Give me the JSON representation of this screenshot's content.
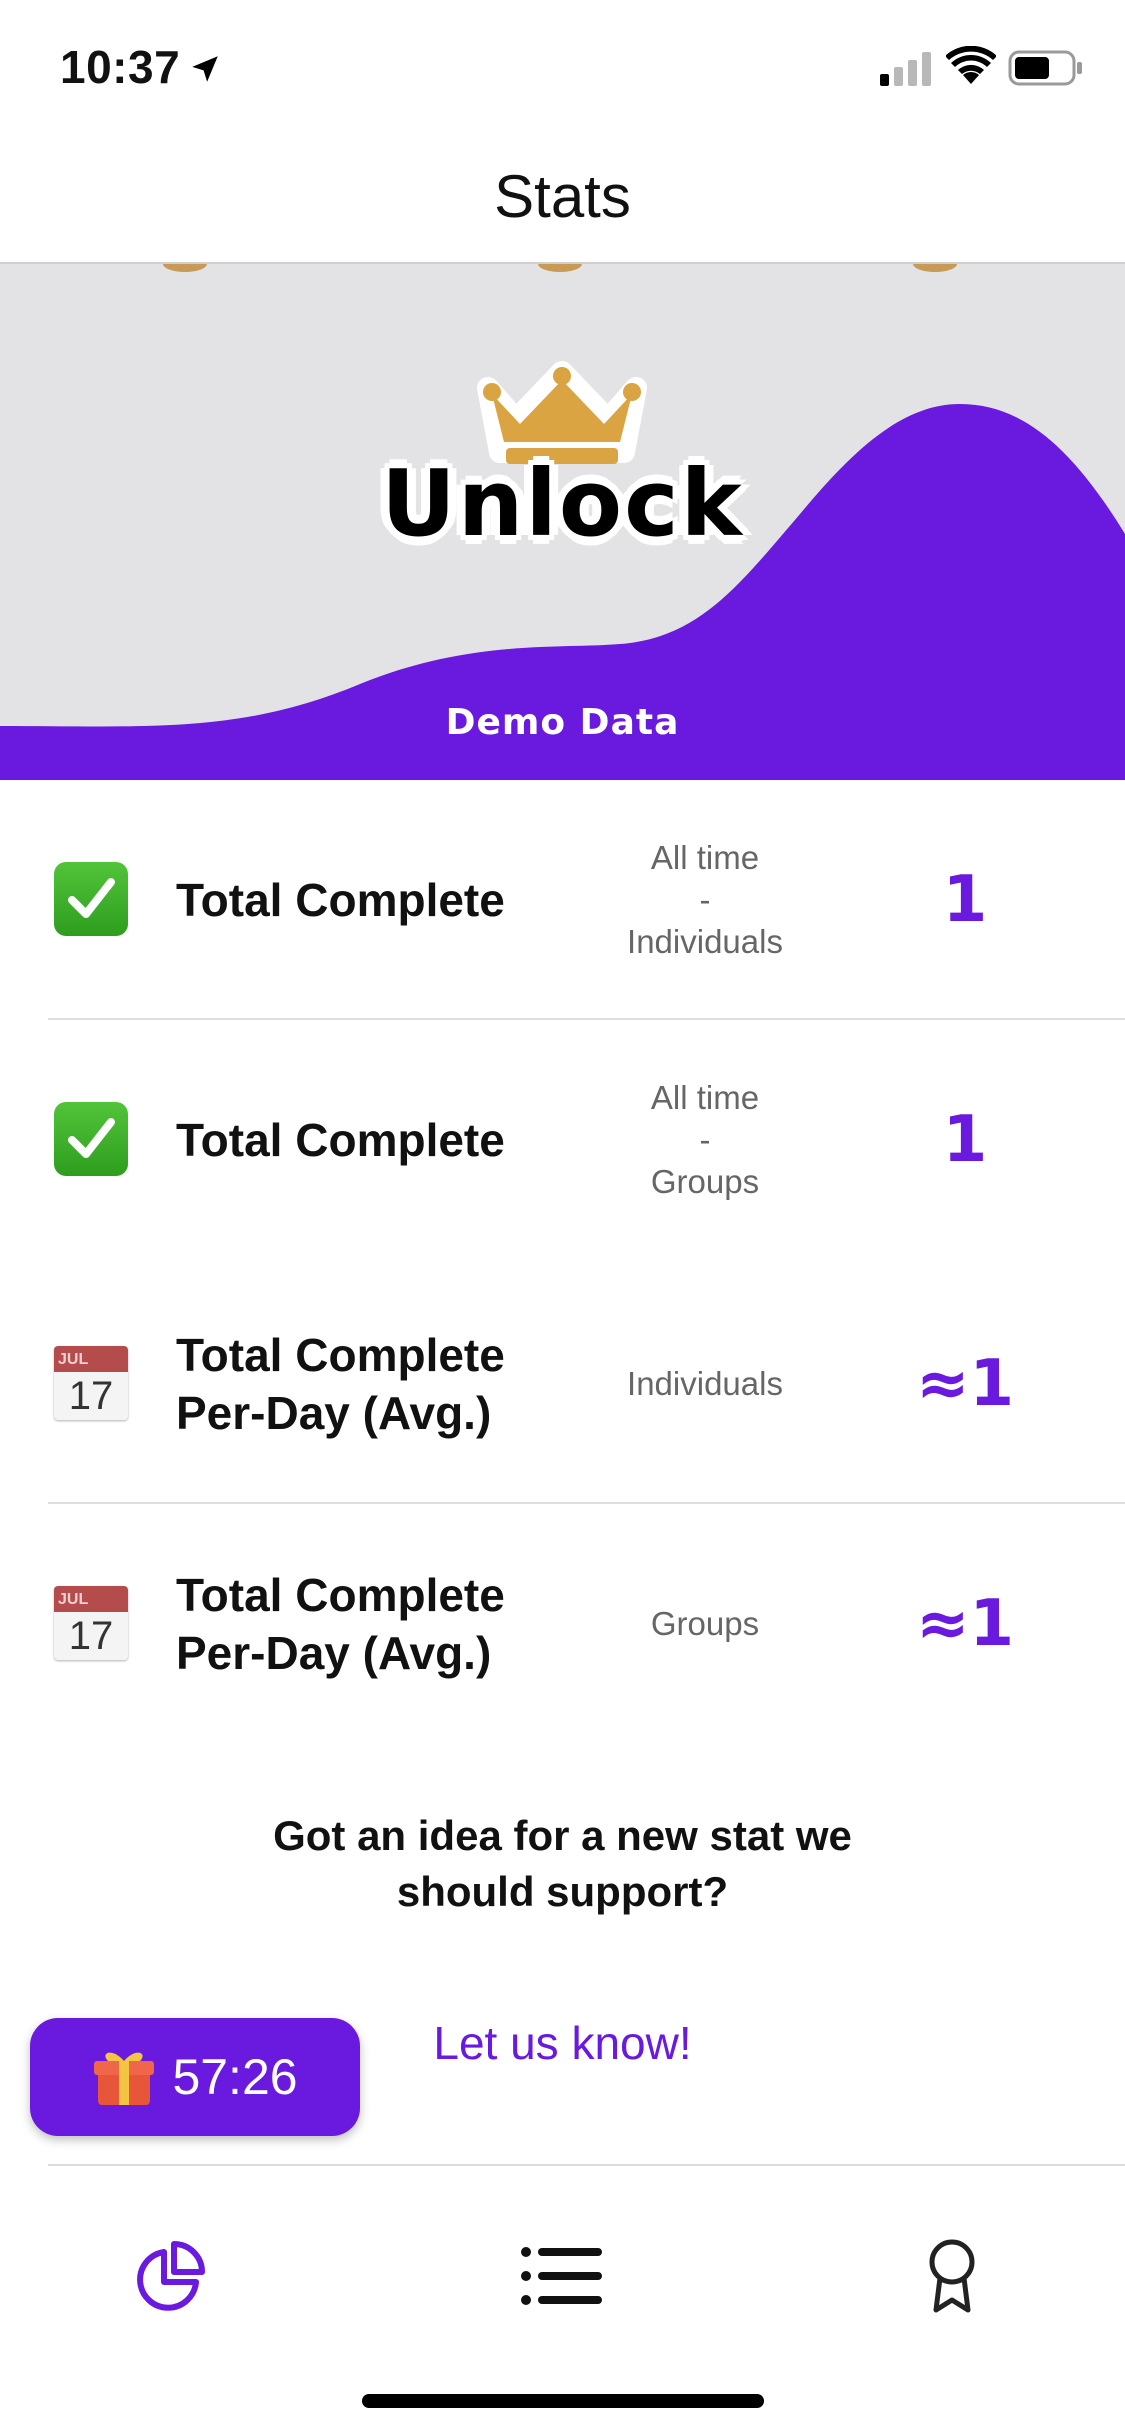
{
  "status_bar": {
    "time": "10:37"
  },
  "nav": {
    "title": "Stats"
  },
  "banner": {
    "unlock_label": "Unlock",
    "demo_label": "Demo Data",
    "colors": {
      "accent": "#6a19df",
      "background": "#e3e3e5",
      "crown": "#d9a441"
    }
  },
  "stats": [
    {
      "icon": "check-mark-icon",
      "label": "Total Complete",
      "scope_lines": [
        "All time",
        "-",
        "Individuals"
      ],
      "value": "1"
    },
    {
      "icon": "check-mark-icon",
      "label": "Total Complete",
      "scope_lines": [
        "All time",
        "-",
        "Groups"
      ],
      "value": "1"
    },
    {
      "icon": "calendar-icon",
      "calendar_month": "JUL",
      "calendar_day": "17",
      "label": "Total Complete Per-Day (Avg.)",
      "scope_lines": [
        "Individuals"
      ],
      "value": "≈1"
    },
    {
      "icon": "calendar-icon",
      "calendar_month": "JUL",
      "calendar_day": "17",
      "label": "Total Complete Per-Day (Avg.)",
      "scope_lines": [
        "Groups"
      ],
      "value": "≈1"
    }
  ],
  "suggestion": {
    "text": "Got an idea for a new stat we should support?",
    "link_label": "Let us know!"
  },
  "gift_timer": {
    "time": "57:26"
  },
  "tabs": [
    {
      "name": "stats",
      "icon": "pie-chart-icon",
      "active": true
    },
    {
      "name": "list",
      "icon": "list-icon",
      "active": false
    },
    {
      "name": "awards",
      "icon": "award-ribbon-icon",
      "active": false
    }
  ]
}
